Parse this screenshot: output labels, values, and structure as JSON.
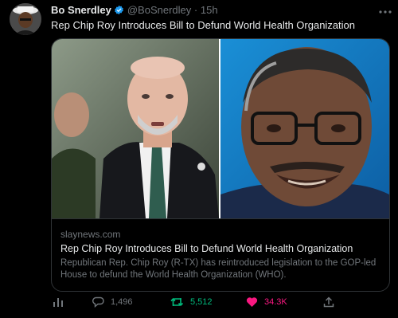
{
  "tweet": {
    "author_name": "Bo Snerdley",
    "handle": "@BoSnerdley",
    "separator": "·",
    "time": "15h",
    "text": "Rep Chip Roy Introduces Bill to Defund World Health Organization",
    "card": {
      "domain": "slaynews.com",
      "title": "Rep Chip Roy Introduces Bill to Defund World Health Organization",
      "description": "Republican Rep. Chip Roy (R-TX) has reintroduced legislation to the GOP-led House to defund the World Health Organization (WHO)."
    },
    "actions": {
      "views_icon": "analytics-icon",
      "replies": "1,496",
      "retweets": "5,512",
      "likes": "34.3K",
      "share_icon": "share-icon"
    }
  },
  "colors": {
    "background": "#000000",
    "text": "#e7e9ea",
    "muted": "#71767b",
    "verified": "#1d9bf0",
    "retweet_active": "#00ba7c",
    "like_active": "#f91880"
  }
}
